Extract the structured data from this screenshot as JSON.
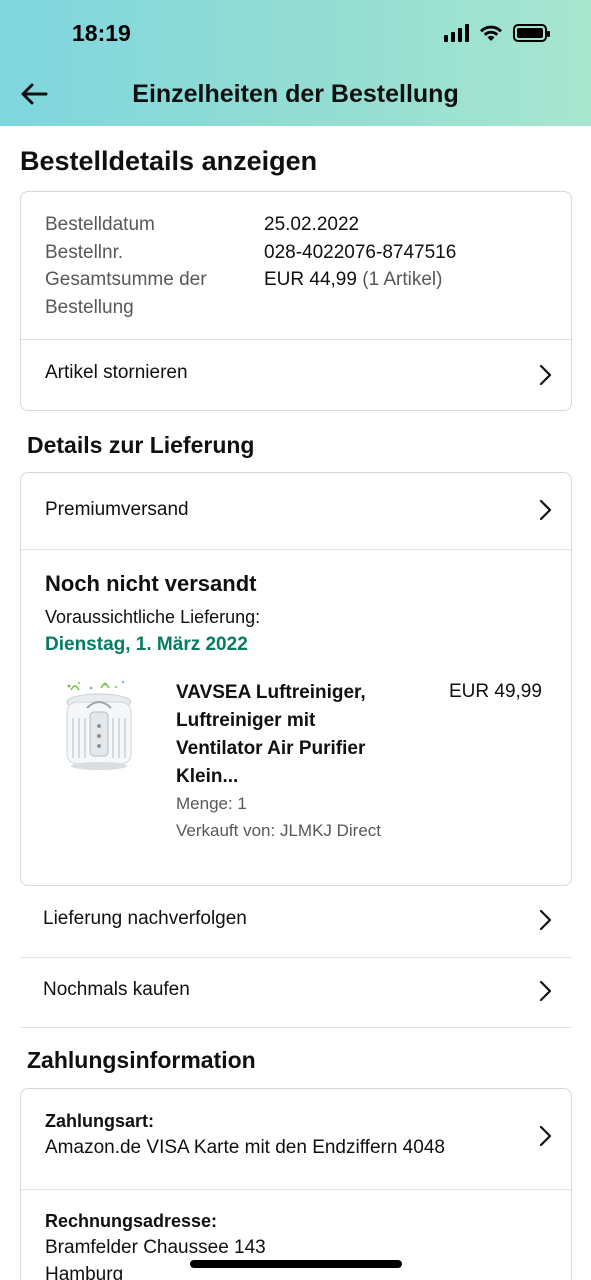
{
  "status_bar": {
    "time": "18:19"
  },
  "header": {
    "title": "Einzelheiten der Bestellung"
  },
  "order_summary": {
    "section_title": "Bestelldetails anzeigen",
    "date_label": "Bestelldatum",
    "date_value": "25.02.2022",
    "number_label": "Bestellnr.",
    "number_value": "028-4022076-8747516",
    "total_label_line1": "Gesamtsumme der",
    "total_label_line2": "Bestellung",
    "total_value": "EUR 44,99",
    "total_items": "(1 Artikel)",
    "cancel_label": "Artikel stornieren"
  },
  "delivery": {
    "section_title": "Details zur Lieferung",
    "shipping_method": "Premiumversand",
    "status": "Noch nicht versandt",
    "expected_label": "Voraussichtliche Lieferung:",
    "expected_date": "Dienstag, 1. März 2022",
    "item": {
      "title_line1": "VAVSEA Luftreiniger,",
      "title_line2": "Luftreiniger mit",
      "title_line3": "Ventilator Air Purifier",
      "title_line4": "Klein...",
      "price": "EUR 49,99",
      "quantity": "Menge: 1",
      "seller": "Verkauft von: JLMKJ Direct"
    },
    "track_label": "Lieferung nachverfolgen",
    "buy_again_label": "Nochmals kaufen"
  },
  "payment": {
    "section_title": "Zahlungsinformation",
    "method_label": "Zahlungsart:",
    "method_value": "Amazon.de VISA Karte mit den Endziffern 4048",
    "billing_label": "Rechnungsadresse:",
    "billing_street": "Bramfelder Chaussee 143",
    "billing_city": "Hamburg"
  },
  "colors": {
    "header_gradient_start": "#7fd6de",
    "header_gradient_end": "#a7e6cf",
    "delivery_green": "#067d62",
    "border": "#d5d9d9"
  },
  "icons": [
    "back-arrow-icon",
    "signal-icon",
    "wifi-icon",
    "battery-icon",
    "chevron-right-icon",
    "product-image"
  ]
}
